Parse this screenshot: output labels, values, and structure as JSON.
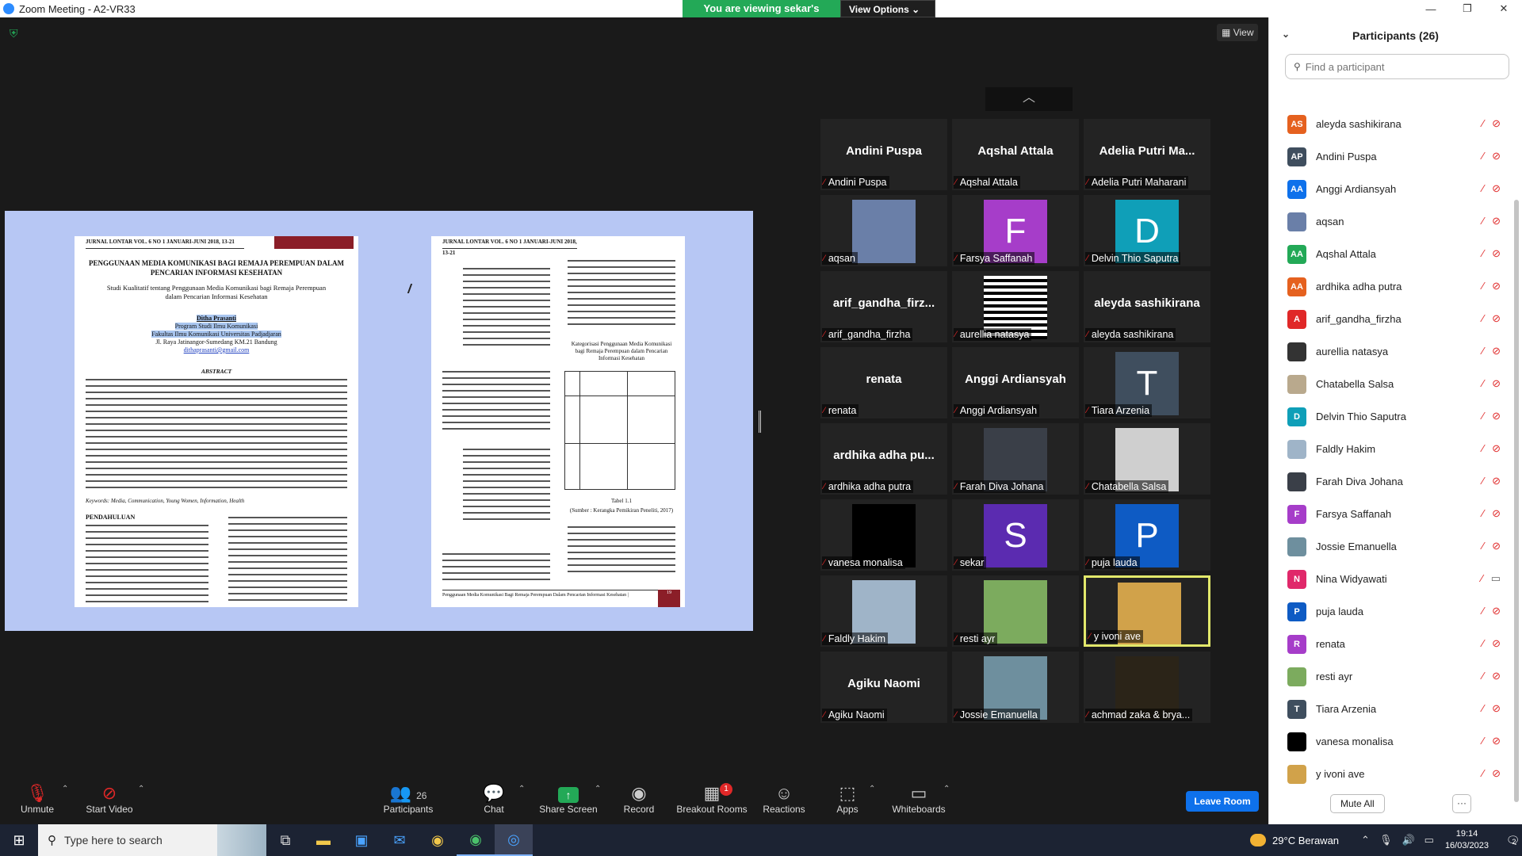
{
  "window": {
    "title": "Zoom Meeting - A2-VR33",
    "banner_text": "You are viewing sekar's screen",
    "view_options_label": "View Options",
    "view_button_label": "View",
    "controls": {
      "minimize": "—",
      "restore": "❐",
      "close": "✕"
    }
  },
  "shared_doc": {
    "journal_header": "JURNAL LONTAR VOL. 6 NO 1 JANUARI-JUNI 2018, 13-21",
    "title": "PENGGUNAAN MEDIA KOMUNIKASI BAGI REMAJA PEREMPUAN DALAM PENCARIAN INFORMASI KESEHATAN",
    "subtitle": "Studi Kualitatif tentang Penggunaan Media Komunikasi bagi Remaja Perempuan dalam Pencarian Informasi Kesehatan",
    "author": "Ditha Prasanti",
    "affiliation1": "Program Studi Ilmu Komunikasi",
    "affiliation2": "Fakultas Ilmu Komunikasi Universitas Padjadjaran",
    "address": "Jl. Raya Jatinangor-Sumedang KM.21 Bandung",
    "email": "dithaprasanti@gmail.com",
    "abstract_heading": "ABSTRACT",
    "keywords": "Keywords: Media, Communication, Young Women, Information, Health",
    "section_heading": "PENDAHULUAN",
    "p2_table_title": "Kategorisasi Penggunaan Media Komunikasi bagi Remaja Perempuan dalam Pencarian Informasi Kesehatan",
    "p2_table_caption": "Tabel 1.1",
    "p2_table_source": "(Sumber : Kerangka Pemikiran Peneliti, 2017)",
    "p2_footer": "Penggunaan Media Komunikasi Bagi Remaja Perempuan Dalam Pencarian Informasi Kesehatan |",
    "p2_page_number": "19"
  },
  "gallery": [
    {
      "big": "Andini Puspa",
      "label": "Andini Puspa",
      "type": "name"
    },
    {
      "big": "Aqshal Attala",
      "label": "Aqshal Attala",
      "type": "name"
    },
    {
      "big": "Adelia Putri Ma...",
      "label": "Adelia Putri Maharani",
      "type": "name"
    },
    {
      "big": "",
      "label": "aqsan",
      "type": "photo",
      "color": "#6a7fa8"
    },
    {
      "big": "F",
      "label": "Farsya Saffanah",
      "type": "letter",
      "color": "#a63dc9"
    },
    {
      "big": "D",
      "label": "Delvin Thio Saputra",
      "type": "letter",
      "color": "#0f9fb8"
    },
    {
      "big": "arif_gandha_firz...",
      "label": "arif_gandha_firzha",
      "type": "name"
    },
    {
      "big": "",
      "label": "aurellia natasya",
      "type": "stripes"
    },
    {
      "big": "aleyda sashikirana",
      "label": "aleyda sashikirana",
      "type": "name"
    },
    {
      "big": "renata",
      "label": "renata",
      "type": "name"
    },
    {
      "big": "Anggi Ardiansyah",
      "label": "Anggi Ardiansyah",
      "type": "name"
    },
    {
      "big": "T",
      "label": "Tiara Arzenia",
      "type": "letter",
      "color": "#3f4e5e"
    },
    {
      "big": "ardhika adha pu...",
      "label": "ardhika adha putra",
      "type": "name"
    },
    {
      "big": "",
      "label": "Farah Diva Johana",
      "type": "photo",
      "color": "#3a3f48"
    },
    {
      "big": "",
      "label": "Chatabella Salsa",
      "type": "photo",
      "color": "#cfcfcf"
    },
    {
      "big": "",
      "label": "vanesa monalisa",
      "type": "photo",
      "color": "#000000"
    },
    {
      "big": "S",
      "label": "sekar",
      "type": "letter",
      "color": "#5b2bb0"
    },
    {
      "big": "P",
      "label": "puja lauda",
      "type": "letter",
      "color": "#0e5bc4"
    },
    {
      "big": "",
      "label": "Faldly Hakim",
      "type": "photo",
      "color": "#9fb4c8"
    },
    {
      "big": "",
      "label": "resti ayr",
      "type": "photo",
      "color": "#7cab5e"
    },
    {
      "big": "",
      "label": "y ivoni ave",
      "type": "photo",
      "color": "#d1a24a",
      "active": true
    },
    {
      "big": "Agiku Naomi",
      "label": "Agiku Naomi",
      "type": "name"
    },
    {
      "big": "",
      "label": "Jossie Emanuella",
      "type": "photo",
      "color": "#6e8f9e"
    },
    {
      "big": "",
      "label": "achmad zaka & brya...",
      "type": "photo",
      "color": "#2b2418"
    }
  ],
  "participants_panel": {
    "title": "Participants (26)",
    "search_placeholder": "Find a participant",
    "mute_all": "Mute All",
    "more": "···",
    "items": [
      {
        "initials": "AS",
        "name": "aleyda sashikirana",
        "color": "#e5611f",
        "cam": "off"
      },
      {
        "initials": "AP",
        "name": "Andini Puspa",
        "color": "#3f4e5e",
        "cam": "off"
      },
      {
        "initials": "AA",
        "name": "Anggi Ardiansyah",
        "color": "#0e71eb",
        "cam": "off"
      },
      {
        "initials": "",
        "name": "aqsan",
        "color": "#6a7fa8",
        "cam": "off"
      },
      {
        "initials": "AA",
        "name": "Aqshal Attala",
        "color": "#23a957",
        "cam": "off"
      },
      {
        "initials": "AA",
        "name": "ardhika adha putra",
        "color": "#e5611f",
        "cam": "off"
      },
      {
        "initials": "A",
        "name": "arif_gandha_firzha",
        "color": "#e02828",
        "cam": "off"
      },
      {
        "initials": "",
        "name": "aurellia natasya",
        "color": "#333333",
        "cam": "off"
      },
      {
        "initials": "",
        "name": "Chatabella Salsa",
        "color": "#b9a98d",
        "cam": "off"
      },
      {
        "initials": "D",
        "name": "Delvin Thio Saputra",
        "color": "#0f9fb8",
        "cam": "off"
      },
      {
        "initials": "",
        "name": "Faldly Hakim",
        "color": "#9fb4c8",
        "cam": "off"
      },
      {
        "initials": "",
        "name": "Farah Diva Johana",
        "color": "#3a3f48",
        "cam": "off"
      },
      {
        "initials": "F",
        "name": "Farsya Saffanah",
        "color": "#a63dc9",
        "cam": "off"
      },
      {
        "initials": "",
        "name": "Jossie Emanuella",
        "color": "#6e8f9e",
        "cam": "off"
      },
      {
        "initials": "N",
        "name": "Nina Widyawati",
        "color": "#e0286a",
        "cam": "on"
      },
      {
        "initials": "P",
        "name": "puja lauda",
        "color": "#0e5bc4",
        "cam": "off"
      },
      {
        "initials": "R",
        "name": "renata",
        "color": "#a63dc9",
        "cam": "off"
      },
      {
        "initials": "",
        "name": "resti ayr",
        "color": "#7cab5e",
        "cam": "off"
      },
      {
        "initials": "T",
        "name": "Tiara Arzenia",
        "color": "#3f4e5e",
        "cam": "off"
      },
      {
        "initials": "",
        "name": "vanesa monalisa",
        "color": "#000000",
        "cam": "off"
      },
      {
        "initials": "",
        "name": "y ivoni ave",
        "color": "#d1a24a",
        "cam": "off"
      }
    ]
  },
  "toolbar": {
    "unmute": "Unmute",
    "start_video": "Start Video",
    "participants": "Participants",
    "participants_count": "26",
    "chat": "Chat",
    "share_screen": "Share Screen",
    "record": "Record",
    "breakout_rooms": "Breakout Rooms",
    "breakout_badge": "1",
    "reactions": "Reactions",
    "apps": "Apps",
    "whiteboards": "Whiteboards",
    "leave_room": "Leave Room"
  },
  "taskbar": {
    "search_placeholder": "Type here to search",
    "temperature": "29°C",
    "weather": "Berawan",
    "time": "19:14",
    "date": "16/03/2023",
    "notification_count": "2"
  }
}
